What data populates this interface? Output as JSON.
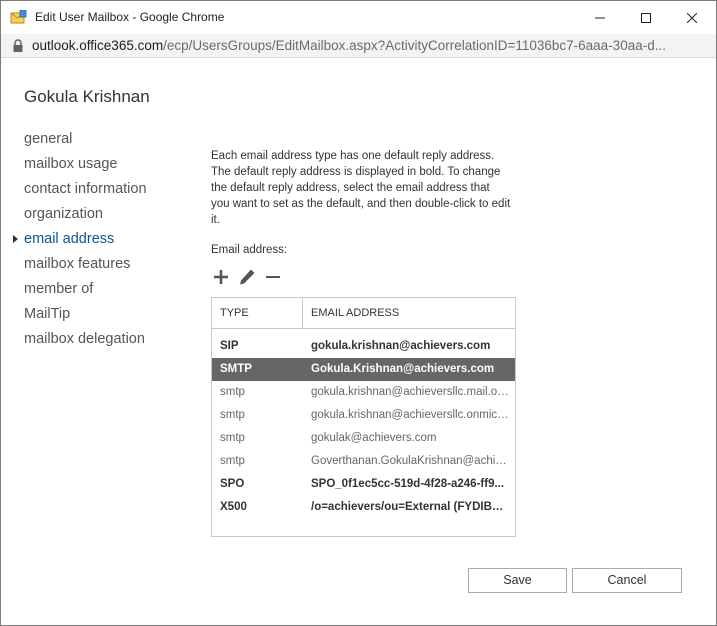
{
  "window": {
    "title": "Edit User Mailbox - Google Chrome",
    "url_host": "outlook.office365.com",
    "url_path": "/ecp/UsersGroups/EditMailbox.aspx?ActivityCorrelationID=11036bc7-6aaa-30aa-d..."
  },
  "user": {
    "name": "Gokula Krishnan"
  },
  "nav": {
    "items": [
      {
        "label": "general"
      },
      {
        "label": "mailbox usage"
      },
      {
        "label": "contact information"
      },
      {
        "label": "organization"
      },
      {
        "label": "email address",
        "active": true
      },
      {
        "label": "mailbox features"
      },
      {
        "label": "member of"
      },
      {
        "label": "MailTip"
      },
      {
        "label": "mailbox delegation"
      }
    ]
  },
  "content": {
    "description": "Each email address type has one default reply address. The default reply address is displayed in bold. To change the default reply address, select the email address that you want to set as the default, and then double-click to edit it.",
    "email_label": "Email address:",
    "toolbar_icons": [
      "plus-icon",
      "pencil-icon",
      "minus-icon"
    ],
    "table": {
      "headers": {
        "type": "TYPE",
        "email": "EMAIL ADDRESS"
      },
      "rows": [
        {
          "type": "SIP",
          "email": "gokula.krishnan@achievers.com",
          "bold": true,
          "selected": false
        },
        {
          "type": "SMTP",
          "email": "Gokula.Krishnan@achievers.com",
          "bold": true,
          "selected": true
        },
        {
          "type": "smtp",
          "email": "gokula.krishnan@achieversllc.mail.onmicrosoft.com",
          "bold": false,
          "selected": false
        },
        {
          "type": "smtp",
          "email": "gokula.krishnan@achieversllc.onmicrosoft.com",
          "bold": false,
          "selected": false
        },
        {
          "type": "smtp",
          "email": "gokulak@achievers.com",
          "bold": false,
          "selected": false
        },
        {
          "type": "smtp",
          "email": "Goverthanan.GokulaKrishnan@achievers.com",
          "bold": false,
          "selected": false
        },
        {
          "type": "SPO",
          "email": "SPO_0f1ec5cc-519d-4f28-a246-ff9...",
          "bold": true,
          "selected": false
        },
        {
          "type": "X500",
          "email": "/o=achievers/ou=External (FYDIBO...",
          "bold": true,
          "selected": false
        }
      ]
    }
  },
  "buttons": {
    "save": "Save",
    "cancel": "Cancel"
  },
  "colors": {
    "active_nav": "#0a5695",
    "selected_row": "#666666"
  }
}
